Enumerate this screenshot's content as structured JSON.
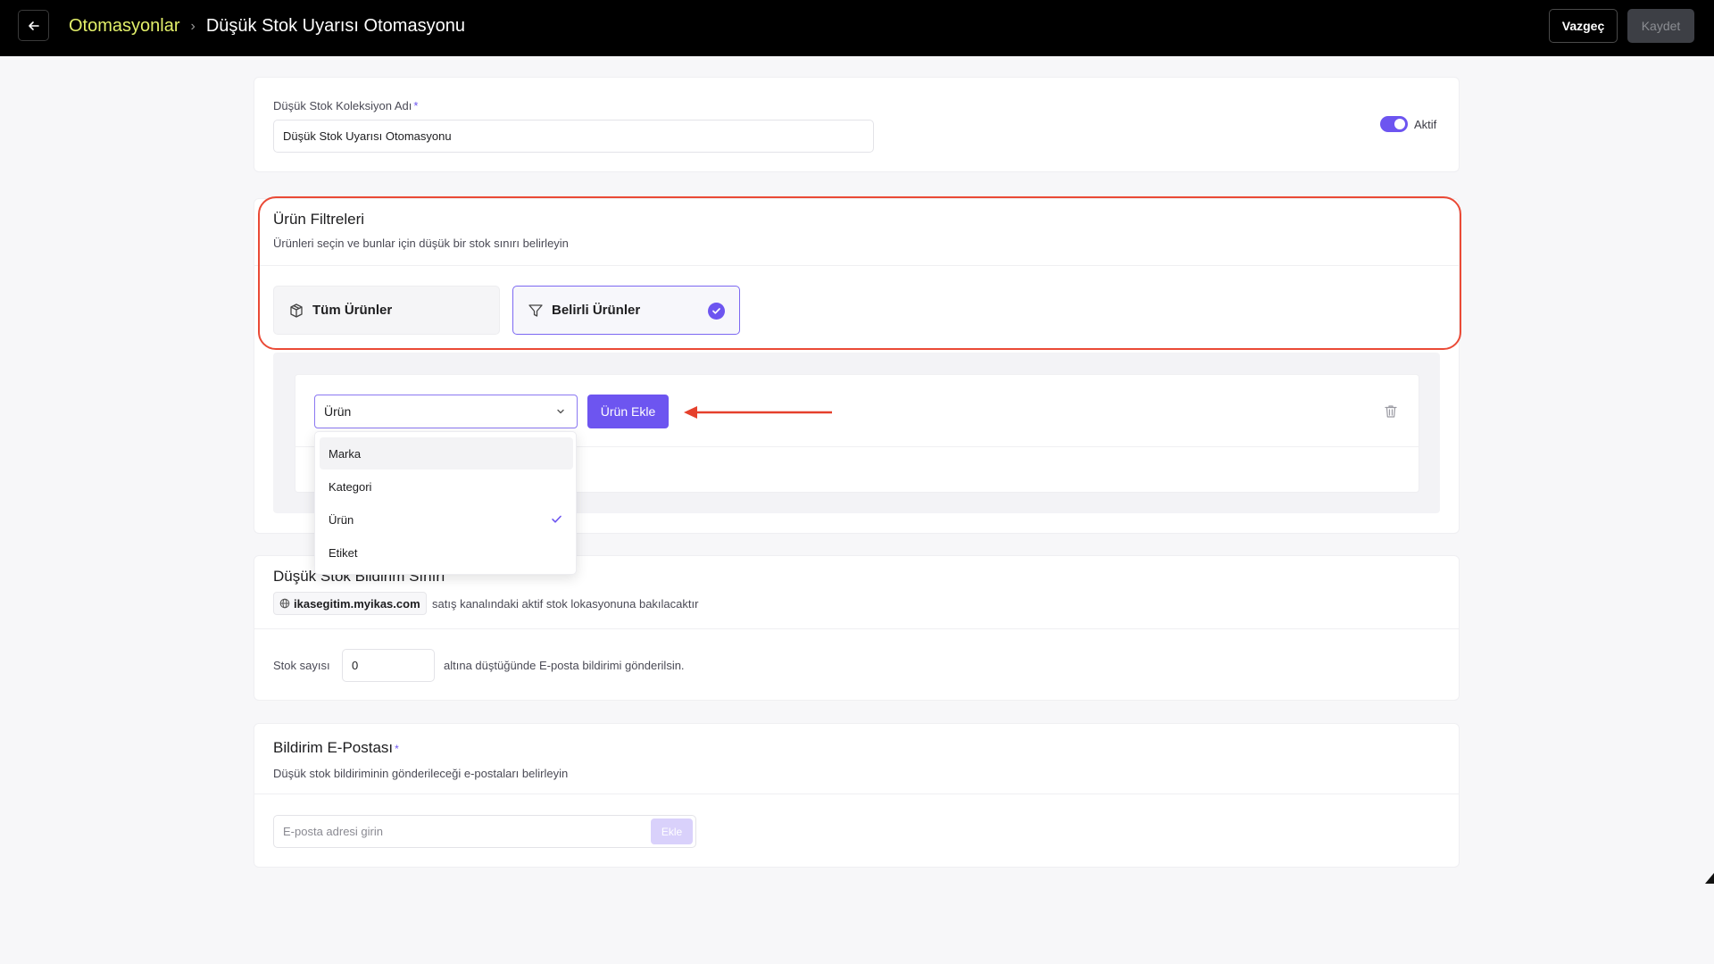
{
  "header": {
    "breadcrumb_parent": "Otomasyonlar",
    "breadcrumb_current": "Düşük Stok Uyarısı Otomasyonu",
    "cancel_label": "Vazgeç",
    "save_label": "Kaydet"
  },
  "collection": {
    "name_label": "Düşük Stok Koleksiyon Adı",
    "required_mark": "*",
    "name_value": "Düşük Stok Uyarısı Otomasyonu",
    "active_label": "Aktif",
    "active": true
  },
  "product_filters": {
    "title": "Ürün Filtreleri",
    "subtitle": "Ürünleri seçin ve bunlar için düşük bir stok sınırı belirleyin",
    "options": [
      {
        "label": "Tüm Ürünler",
        "icon": "box-icon",
        "selected": false
      },
      {
        "label": "Belirli Ürünler",
        "icon": "filter-icon",
        "selected": true
      }
    ],
    "filter_type_selected": "Ürün",
    "add_button": "Ürün Ekle",
    "dropdown_options": [
      {
        "label": "Marka",
        "selected": false
      },
      {
        "label": "Kategori",
        "selected": false
      },
      {
        "label": "Ürün",
        "selected": true
      },
      {
        "label": "Etiket",
        "selected": false
      }
    ]
  },
  "stock_limit": {
    "title": "Düşük Stok Bildirim Sınırı",
    "domain": "ikasegitim.myikas.com",
    "domain_note": "satış kanalındaki aktif stok lokasyonuna bakılacaktır",
    "stock_label": "Stok sayısı",
    "stock_value": "0",
    "stock_note": "altına düştüğünde E-posta bildirimi gönderilsin."
  },
  "notification_email": {
    "title": "Bildirim E-Postası",
    "required_mark": "*",
    "subtitle": "Düşük stok bildiriminin gönderileceği e-postaları belirleyin",
    "placeholder": "E-posta adresi girin",
    "add_label": "Ekle"
  },
  "colors": {
    "accent": "#6d55f0",
    "highlight": "#ea4a36",
    "breadcrumb_link": "#e3f06a"
  }
}
